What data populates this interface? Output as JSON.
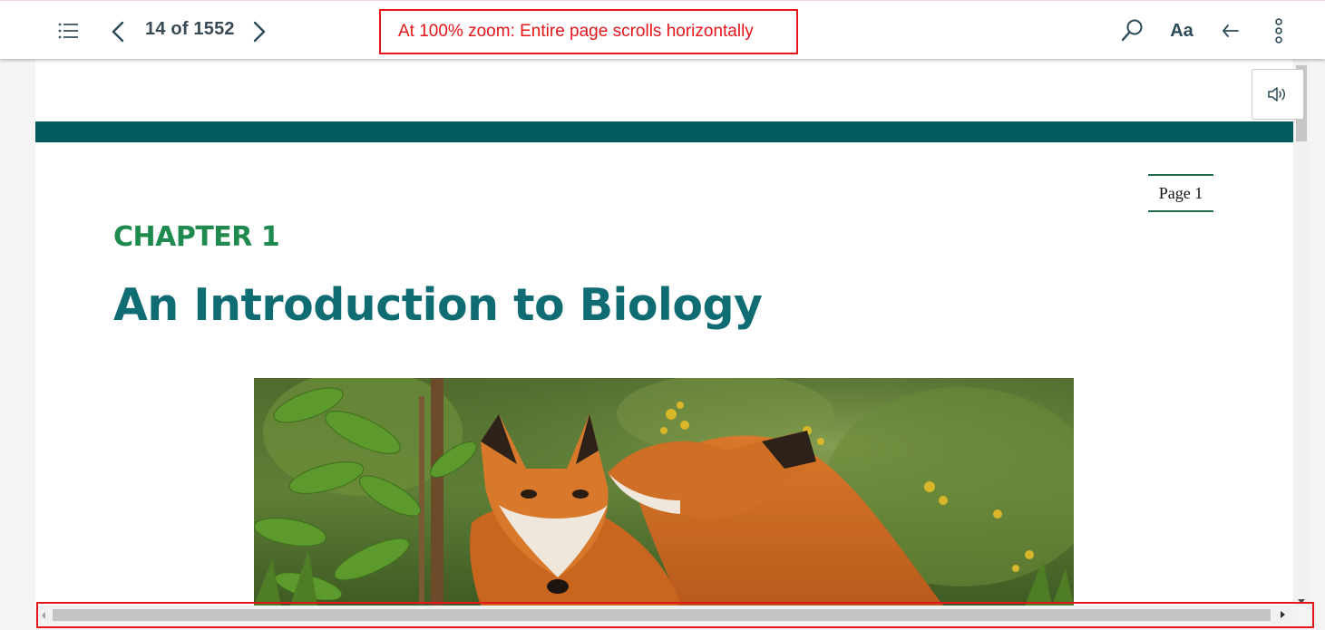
{
  "toolbar": {
    "page_counter": "14 of 1552",
    "annotation_text": "At 100% zoom: Entire page scrolls horizontally",
    "font_button_label": "Aa",
    "icons": [
      "toc-list-icon",
      "chevron-left-icon",
      "chevron-right-icon",
      "search-icon",
      "back-arrow-icon",
      "more-vertical-icon"
    ]
  },
  "page": {
    "page_label": "Page 1",
    "chapter_label": "CHAPTER 1",
    "chapter_title": "An Introduction to Biology",
    "image_subject": "two red foxes in green foliage",
    "accent_color": "#035a5f",
    "chapter_color": "#1e8a4e",
    "title_color": "#0f6c72"
  },
  "audio": {
    "icon": "speaker-icon"
  },
  "annotation_color": "#e4151b"
}
